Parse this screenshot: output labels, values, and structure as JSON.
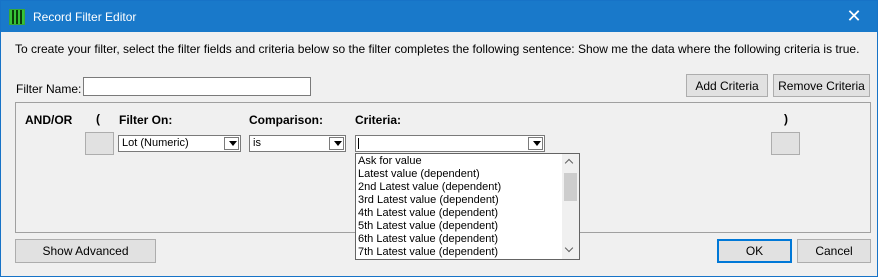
{
  "window": {
    "title": "Record Filter Editor",
    "close_glyph": "✕"
  },
  "instructions": "To create your filter, select the filter fields and criteria below so the filter completes the following sentence: Show me the data where the following criteria is true.",
  "filter_name": {
    "label": "Filter Name:",
    "value": ""
  },
  "buttons": {
    "add_criteria": "Add Criteria",
    "remove_criteria": "Remove Criteria",
    "show_advanced": "Show Advanced",
    "ok": "OK",
    "cancel": "Cancel"
  },
  "columns": {
    "and_or": "AND/OR",
    "open_paren": "(",
    "filter_on": "Filter On:",
    "comparison": "Comparison:",
    "criteria": "Criteria:",
    "close_paren": ")"
  },
  "row": {
    "filter_on_value": "Lot (Numeric)",
    "comparison_value": "is",
    "criteria_value": ""
  },
  "criteria_options": [
    "Ask for value",
    "Latest value (dependent)",
    "2nd Latest value (dependent)",
    "3rd Latest value (dependent)",
    "4th Latest value (dependent)",
    "5th Latest value (dependent)",
    "6th Latest value (dependent)",
    "7th Latest value (dependent)"
  ],
  "icons": {
    "app": "app-grid-icon",
    "close": "close-icon",
    "dropdown": "chevron-down-icon",
    "scroll_up": "chevron-up-icon",
    "scroll_down": "chevron-down-icon"
  },
  "colors": {
    "titlebar": "#1979ca",
    "panel": "#f0f0f0",
    "button": "#e1e1e1",
    "default_button_border": "#0078d7"
  }
}
